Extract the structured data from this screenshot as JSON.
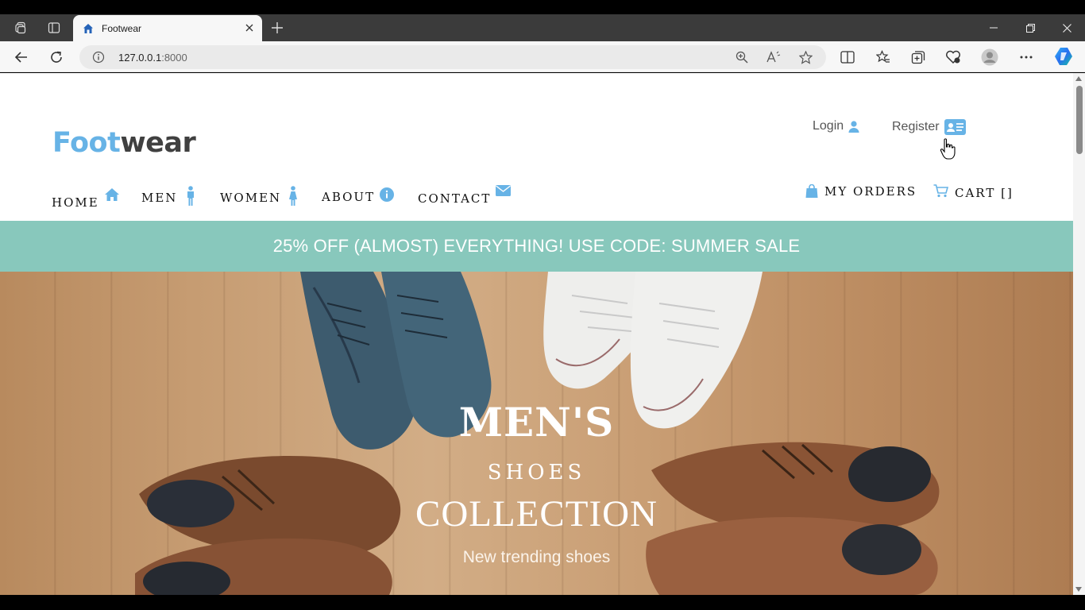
{
  "browser": {
    "tab_title": "Footwear",
    "url_host": "127.0.0.1",
    "url_port": ":8000"
  },
  "site": {
    "logo_part1": "Foot",
    "logo_part2": "wear",
    "login_label": "Login",
    "register_label": "Register",
    "nav": {
      "home": "HOME",
      "men": "MEN",
      "women": "WOMEN",
      "about": "ABOUT",
      "contact": "CONTACT",
      "my_orders": "MY ORDERS",
      "cart": "CART []"
    },
    "promo": "25% OFF (ALMOST) EVERYTHING! USE CODE: SUMMER SALE",
    "hero": {
      "line1": "MEN'S",
      "line2": "SHOES",
      "line3": "COLLECTION",
      "line4": "New trending shoes"
    }
  },
  "colors": {
    "accent": "#67b3e6",
    "logo_dark": "#404040",
    "promo_bg": "#88c8bc"
  }
}
